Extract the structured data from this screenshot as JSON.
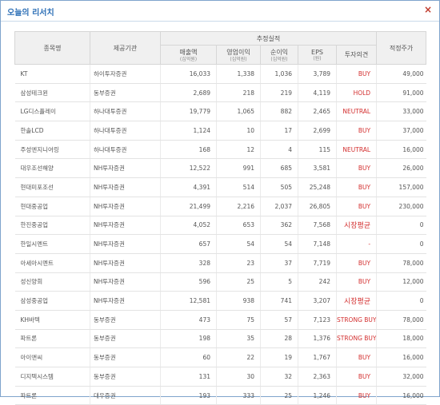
{
  "window": {
    "title": "오늘의 리서치"
  },
  "table": {
    "headers": {
      "name": "종목명",
      "institution": "제공기관",
      "group": "추정실적",
      "sales": "매출액",
      "sales_unit": "(십억원)",
      "op_profit": "영업이익",
      "op_profit_unit": "(십억원)",
      "net_profit": "순이익",
      "net_profit_unit": "(십억원)",
      "eps": "EPS",
      "eps_unit": "(원)",
      "opinion": "투자의견",
      "target": "적정주가"
    },
    "rows": [
      {
        "name": "KT",
        "inst": "하이투자증권",
        "sales": "16,033",
        "op": "1,338",
        "net": "1,036",
        "eps": "3,789",
        "opinion": "BUY",
        "target": "49,000"
      },
      {
        "name": "삼성테크윈",
        "inst": "동부증권",
        "sales": "2,689",
        "op": "218",
        "net": "219",
        "eps": "4,119",
        "opinion": "HOLD",
        "target": "91,000"
      },
      {
        "name": "LG디스플레이",
        "inst": "하나대투증권",
        "sales": "19,779",
        "op": "1,065",
        "net": "882",
        "eps": "2,465",
        "opinion": "NEUTRAL",
        "target": "33,000"
      },
      {
        "name": "한솔LCD",
        "inst": "하나대투증권",
        "sales": "1,124",
        "op": "10",
        "net": "17",
        "eps": "2,699",
        "opinion": "BUY",
        "target": "37,000"
      },
      {
        "name": "주성엔지니어링",
        "inst": "하나대투증권",
        "sales": "168",
        "op": "12",
        "net": "4",
        "eps": "115",
        "opinion": "NEUTRAL",
        "target": "16,000"
      },
      {
        "name": "대우조선해양",
        "inst": "NH투자증권",
        "sales": "12,522",
        "op": "991",
        "net": "685",
        "eps": "3,581",
        "opinion": "BUY",
        "target": "26,000"
      },
      {
        "name": "현대미포조선",
        "inst": "NH투자증권",
        "sales": "4,391",
        "op": "514",
        "net": "505",
        "eps": "25,248",
        "opinion": "BUY",
        "target": "157,000"
      },
      {
        "name": "현대중공업",
        "inst": "NH투자증권",
        "sales": "21,499",
        "op": "2,216",
        "net": "2,037",
        "eps": "26,805",
        "opinion": "BUY",
        "target": "230,000"
      },
      {
        "name": "한진중공업",
        "inst": "NH투자증권",
        "sales": "4,052",
        "op": "653",
        "net": "362",
        "eps": "7,568",
        "opinion": "시장평균",
        "target": "0"
      },
      {
        "name": "한일시멘트",
        "inst": "NH투자증권",
        "sales": "657",
        "op": "54",
        "net": "54",
        "eps": "7,148",
        "opinion": "-",
        "target": "0"
      },
      {
        "name": "아세아시멘트",
        "inst": "NH투자증권",
        "sales": "328",
        "op": "23",
        "net": "37",
        "eps": "7,719",
        "opinion": "BUY",
        "target": "78,000"
      },
      {
        "name": "성신양회",
        "inst": "NH투자증권",
        "sales": "596",
        "op": "25",
        "net": "5",
        "eps": "242",
        "opinion": "BUY",
        "target": "12,000"
      },
      {
        "name": "삼성중공업",
        "inst": "NH투자증권",
        "sales": "12,581",
        "op": "938",
        "net": "741",
        "eps": "3,207",
        "opinion": "시장평균",
        "target": "0"
      },
      {
        "name": "KH바텍",
        "inst": "동부증권",
        "sales": "473",
        "op": "75",
        "net": "57",
        "eps": "7,123",
        "opinion": "STRONG BUY",
        "target": "78,000"
      },
      {
        "name": "파트론",
        "inst": "동부증권",
        "sales": "198",
        "op": "35",
        "net": "28",
        "eps": "1,376",
        "opinion": "STRONG BUY",
        "target": "18,000"
      },
      {
        "name": "아이앤씨",
        "inst": "동부증권",
        "sales": "60",
        "op": "22",
        "net": "19",
        "eps": "1,767",
        "opinion": "BUY",
        "target": "16,000"
      },
      {
        "name": "디지텍시스템",
        "inst": "동부증권",
        "sales": "131",
        "op": "30",
        "net": "32",
        "eps": "2,363",
        "opinion": "BUY",
        "target": "32,000"
      },
      {
        "name": "파트론",
        "inst": "대우증권",
        "sales": "193",
        "op": "333",
        "net": "25",
        "eps": "1,246",
        "opinion": "BUY",
        "target": "16,000"
      }
    ]
  },
  "colors": {
    "accent": "#2d6fb6",
    "opinion": "#d32f2f",
    "border": "#7fa4cc"
  },
  "icons": {
    "close": "close-icon"
  }
}
